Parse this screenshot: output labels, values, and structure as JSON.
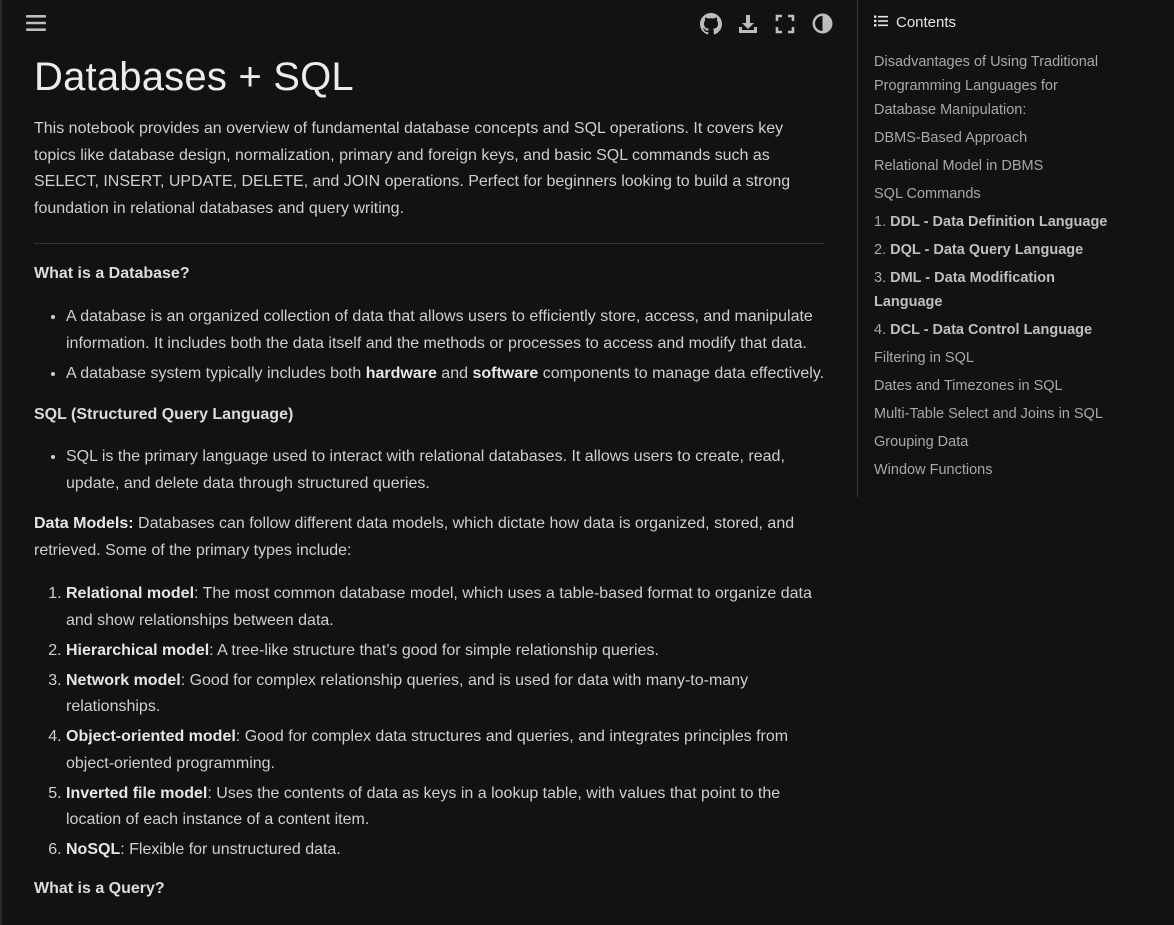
{
  "toolbar": {
    "menu_icon": "hamburger-icon",
    "github_icon": "github-icon",
    "download_icon": "download-icon",
    "fullscreen_icon": "fullscreen-icon",
    "theme_icon": "contrast-icon"
  },
  "page": {
    "title": "Databases + SQL",
    "intro": "This notebook provides an overview of fundamental database concepts and SQL operations. It covers key topics like database design, normalization, primary and foreign keys, and basic SQL commands such as SELECT, INSERT, UPDATE, DELETE, and JOIN operations. Perfect for beginners looking to build a strong foundation in relational databases and query writing."
  },
  "what_is_db": {
    "heading": "What is a Database?",
    "bullet1": "A database is an organized collection of data that allows users to efficiently store, access, and manipulate information. It includes both the data itself and the methods or processes to access and modify that data.",
    "bullet2_pre": "A database system typically includes both ",
    "bullet2_b1": "hardware",
    "bullet2_mid": " and ",
    "bullet2_b2": "software",
    "bullet2_post": " components to manage data effectively."
  },
  "sql": {
    "heading": "SQL (Structured Query Language)",
    "bullet1": "SQL is the primary language used to interact with relational databases. It allows users to create, read, update, and delete data through structured queries."
  },
  "data_models": {
    "label": "Data Models:",
    "text": " Databases can follow different data models, which dictate how data is organized, stored, and retrieved. Some of the primary types include:",
    "items": [
      {
        "term": "Relational model",
        "desc": ": The most common database model, which uses a table-based format to organize data and show relationships between data."
      },
      {
        "term": "Hierarchical model",
        "desc": ": A tree-like structure that’s good for simple relationship queries."
      },
      {
        "term": "Network model",
        "desc": ": Good for complex relationship queries, and is used for data with many-to-many relationships."
      },
      {
        "term": "Object-oriented model",
        "desc": ": Good for complex data structures and queries, and integrates principles from object-oriented programming."
      },
      {
        "term": "Inverted file model",
        "desc": ": Uses the contents of data as keys in a lookup table, with values that point to the location of each instance of a content item."
      },
      {
        "term": "NoSQL",
        "desc": ": Flexible for unstructured data."
      }
    ]
  },
  "query": {
    "heading": "What is a Query?"
  },
  "toc": {
    "icon": "list-icon",
    "title": "Contents",
    "items": [
      {
        "prefix": "",
        "bold": "",
        "text": "Disadvantages of Using Traditional Programming Languages for Database Manipulation:"
      },
      {
        "prefix": "",
        "bold": "",
        "text": "DBMS-Based Approach"
      },
      {
        "prefix": "",
        "bold": "",
        "text": "Relational Model in DBMS"
      },
      {
        "prefix": "",
        "bold": "",
        "text": "SQL Commands"
      },
      {
        "prefix": "1. ",
        "bold": "DDL - Data Definition Language",
        "text": ""
      },
      {
        "prefix": "2. ",
        "bold": "DQL - Data Query Language",
        "text": ""
      },
      {
        "prefix": "3. ",
        "bold": "DML - Data Modification Language",
        "text": ""
      },
      {
        "prefix": "4. ",
        "bold": "DCL - Data Control Language",
        "text": ""
      },
      {
        "prefix": "",
        "bold": "",
        "text": "Filtering in SQL"
      },
      {
        "prefix": "",
        "bold": "",
        "text": "Dates and Timezones in SQL"
      },
      {
        "prefix": "",
        "bold": "",
        "text": "Multi-Table Select and Joins in SQL"
      },
      {
        "prefix": "",
        "bold": "",
        "text": "Grouping Data"
      },
      {
        "prefix": "",
        "bold": "",
        "text": "Window Functions"
      }
    ]
  }
}
